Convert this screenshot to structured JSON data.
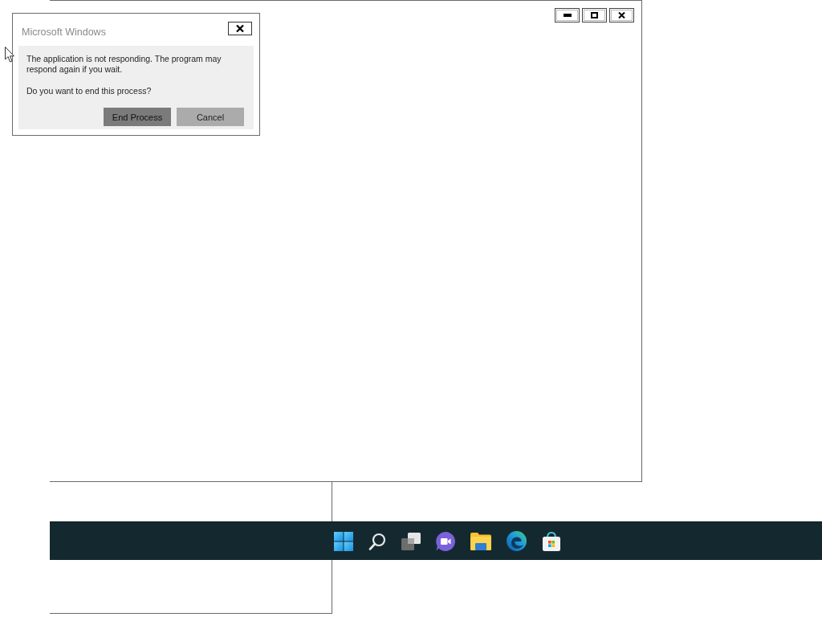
{
  "window": {
    "controls": [
      {
        "kind": "minimize"
      },
      {
        "kind": "maximize"
      },
      {
        "kind": "close"
      }
    ]
  },
  "dialog": {
    "title": "Microsoft Windows",
    "message": "The application is not responding. The program may respond again if you wait.",
    "question": "Do you want to end this process?",
    "buttons": [
      {
        "label": "End Process",
        "focused": true
      },
      {
        "label": "Cancel",
        "focused": false
      }
    ]
  },
  "taskbar": {
    "icons": [
      {
        "kind": "start"
      },
      {
        "kind": "search"
      },
      {
        "kind": "task-view"
      },
      {
        "kind": "chat"
      },
      {
        "kind": "folder"
      },
      {
        "kind": "browser"
      },
      {
        "kind": "store"
      }
    ]
  }
}
